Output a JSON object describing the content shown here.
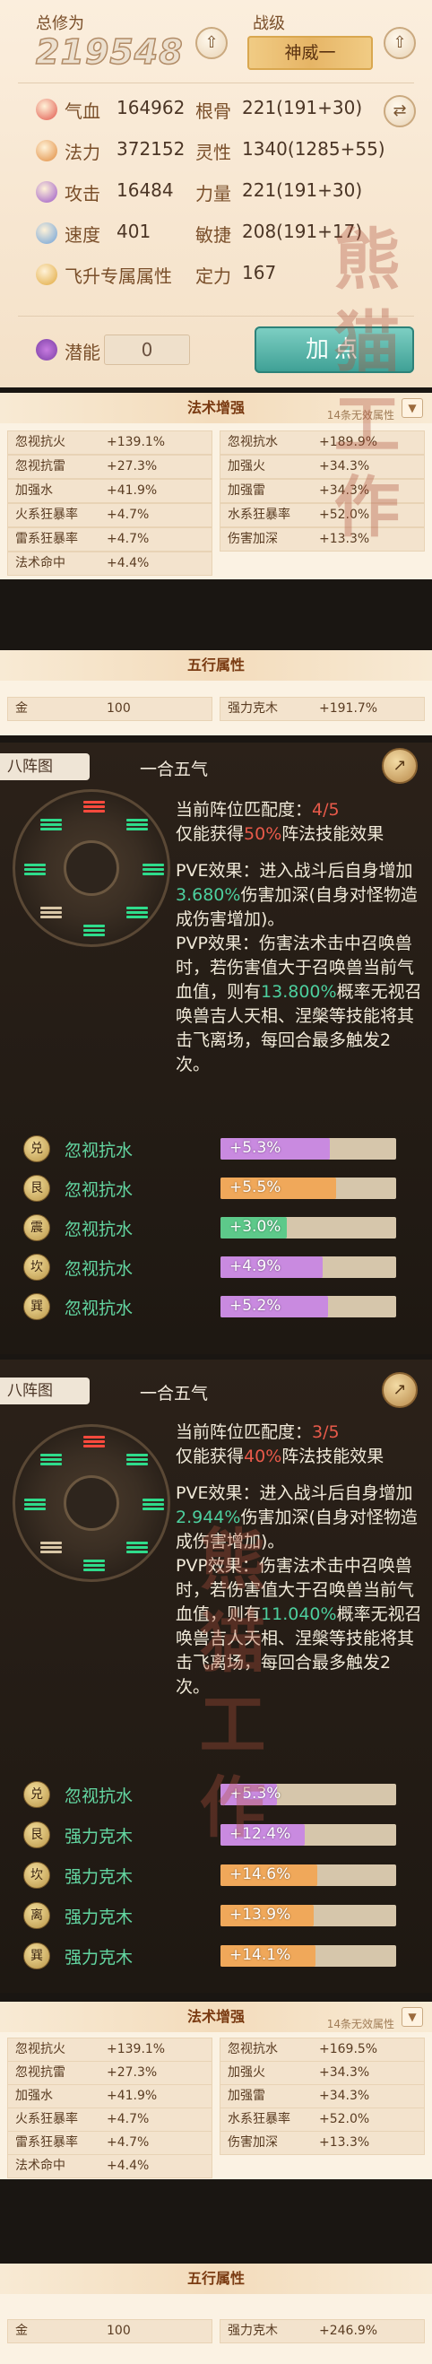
{
  "character": {
    "cultivation_label": "总修为",
    "cultivation_value": "219548",
    "rank_label": "战级",
    "rank_value": "神威一",
    "stats": [
      {
        "label": "气血",
        "value": "164962",
        "icon": "blood-icon",
        "color": "#e0544a"
      },
      {
        "label": "法力",
        "value": "372152",
        "icon": "mana-icon",
        "color": "#e08a3c"
      },
      {
        "label": "攻击",
        "value": "16484",
        "icon": "attack-icon",
        "color": "#9a55c8"
      },
      {
        "label": "速度",
        "value": "401",
        "icon": "speed-icon",
        "color": "#6a9fd8"
      },
      {
        "label": "飞升专属属性",
        "value": "",
        "icon": "ascension-icon",
        "color": "#e0a73a"
      }
    ],
    "attrs": [
      {
        "label": "根骨",
        "value": "221(191+30)"
      },
      {
        "label": "灵性",
        "value": "1340(1285+55)"
      },
      {
        "label": "力量",
        "value": "221(191+30)"
      },
      {
        "label": "敏捷",
        "value": "208(191+17)"
      },
      {
        "label": "定力",
        "value": "167"
      }
    ],
    "potential_label": "潜能",
    "potential_value": "0",
    "add_point_label": "加点"
  },
  "spell_boost_1": {
    "title": "法术增强",
    "note": "14条无效属性",
    "rows": [
      [
        "忽视抗火",
        "+139.1%",
        "忽视抗水",
        "+189.9%"
      ],
      [
        "忽视抗雷",
        "+27.3%",
        "加强火",
        "+34.3%"
      ],
      [
        "加强水",
        "+41.9%",
        "加强雷",
        "+34.3%"
      ],
      [
        "火系狂暴率",
        "+4.7%",
        "水系狂暴率",
        "+52.0%"
      ],
      [
        "雷系狂暴率",
        "+4.7%",
        "伤害加深",
        "+13.3%"
      ],
      [
        "法术命中",
        "+4.4%",
        "",
        ""
      ]
    ]
  },
  "five_elements_1": {
    "title": "五行属性",
    "rows": [
      [
        "金",
        "100",
        "强力克木",
        "+191.7%"
      ]
    ]
  },
  "formation_1": {
    "tab_label": "八阵图",
    "name": "一合五气",
    "match_prefix": "当前阵位匹配度：",
    "match_value": "4/5",
    "gain_prefix": "仅能获得",
    "gain_value": "50%",
    "gain_suffix": "阵法技能效果",
    "pve_a": "PVE效果：进入战斗后自身增加",
    "pve_val": "3.680%",
    "pve_b": "伤害加深(自身对怪物造成伤害增加)。",
    "pvp_a": "PVP效果：伤害法术击中召唤兽时，若伤害值大于召唤兽当前气血值，则有",
    "pvp_val": "13.800%",
    "pvp_b": "概率无视召唤兽吉人天相、涅槃等技能将其击飞离场，每回合最多触发2次。",
    "elements": [
      {
        "badge": "兑",
        "name": "忽视抗水",
        "value": "+5.3%",
        "fill": 0.62,
        "color": "#c98ae0"
      },
      {
        "badge": "艮",
        "name": "忽视抗水",
        "value": "+5.5%",
        "fill": 0.66,
        "color": "#f0a85a"
      },
      {
        "badge": "震",
        "name": "忽视抗水",
        "value": "+3.0%",
        "fill": 0.38,
        "color": "#5dc98a"
      },
      {
        "badge": "坎",
        "name": "忽视抗水",
        "value": "+4.9%",
        "fill": 0.58,
        "color": "#c98ae0"
      },
      {
        "badge": "巽",
        "name": "忽视抗水",
        "value": "+5.2%",
        "fill": 0.61,
        "color": "#c98ae0"
      }
    ]
  },
  "formation_2": {
    "tab_label": "八阵图",
    "name": "一合五气",
    "match_prefix": "当前阵位匹配度：",
    "match_value": "3/5",
    "gain_prefix": "仅能获得",
    "gain_value": "40%",
    "gain_suffix": "阵法技能效果",
    "pve_a": "PVE效果：进入战斗后自身增加",
    "pve_val": "2.944%",
    "pve_b": "伤害加深(自身对怪物造成伤害增加)。",
    "pvp_a": "PVP效果：伤害法术击中召唤兽时，若伤害值大于召唤兽当前气血值，则有",
    "pvp_val": "11.040%",
    "pvp_b": "概率无视召唤兽吉人天相、涅槃等技能将其击飞离场，每回合最多触发2次。",
    "elements": [
      {
        "badge": "兑",
        "name": "忽视抗水",
        "value": "+5.3%",
        "fill": 0.32,
        "color": "#c98ae0"
      },
      {
        "badge": "艮",
        "name": "强力克木",
        "value": "+12.4%",
        "fill": 0.48,
        "color": "#c98ae0"
      },
      {
        "badge": "坎",
        "name": "强力克木",
        "value": "+14.6%",
        "fill": 0.55,
        "color": "#f0a85a"
      },
      {
        "badge": "离",
        "name": "强力克木",
        "value": "+13.9%",
        "fill": 0.53,
        "color": "#f0a85a"
      },
      {
        "badge": "巽",
        "name": "强力克木",
        "value": "+14.1%",
        "fill": 0.54,
        "color": "#f0a85a"
      }
    ]
  },
  "spell_boost_2": {
    "title": "法术增强",
    "note": "14条无效属性",
    "rows": [
      [
        "忽视抗火",
        "+139.1%",
        "忽视抗水",
        "+169.5%"
      ],
      [
        "忽视抗雷",
        "+27.3%",
        "加强火",
        "+34.3%"
      ],
      [
        "加强水",
        "+41.9%",
        "加强雷",
        "+34.3%"
      ],
      [
        "火系狂暴率",
        "+4.7%",
        "水系狂暴率",
        "+52.0%"
      ],
      [
        "雷系狂暴率",
        "+4.7%",
        "伤害加深",
        "+13.3%"
      ],
      [
        "法术命中",
        "+4.4%",
        "",
        ""
      ]
    ]
  },
  "five_elements_2": {
    "title": "五行属性",
    "rows": [
      [
        "金",
        "100",
        "强力克木",
        "+246.9%"
      ]
    ]
  },
  "watermark": "熊猫工作"
}
